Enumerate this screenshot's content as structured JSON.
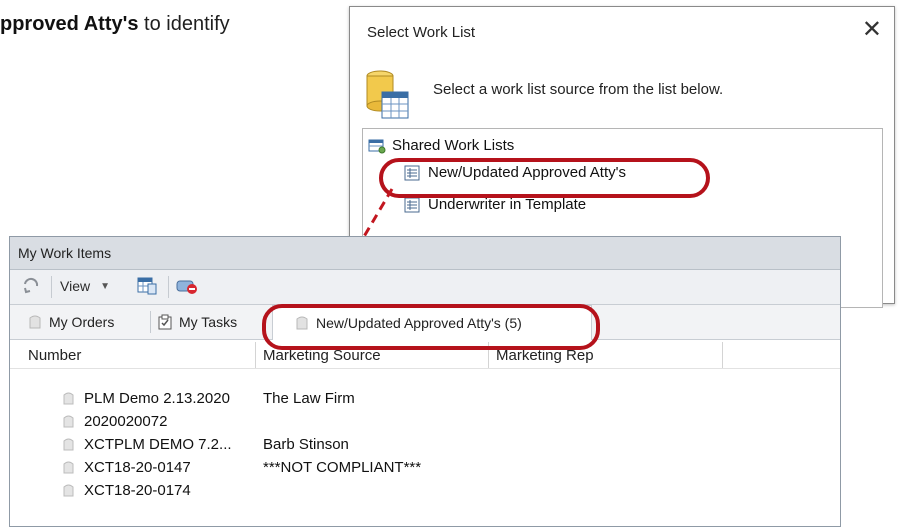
{
  "instruction": {
    "bold_part": "pproved Atty's",
    "rest": " to identify"
  },
  "dialog": {
    "title": "Select Work List",
    "close_glyph": "✕",
    "prompt": "Select a work list source from the list below.",
    "icon": "database-list-icon",
    "tree": {
      "root_label": "Shared Work Lists",
      "items": [
        {
          "label": "New/Updated Approved Atty's",
          "icon": "list-icon"
        },
        {
          "label": "Underwriter in Template",
          "icon": "list-icon"
        }
      ]
    }
  },
  "panel": {
    "title": "My Work Items",
    "toolbar": {
      "view_label": "View",
      "icons": [
        "refresh-icon",
        "chevron-down-icon",
        "grid-icon",
        "remove-worklist-icon"
      ]
    },
    "tabs": [
      {
        "label": "My Orders",
        "icon": "orders-icon"
      },
      {
        "label": "My Tasks",
        "icon": "tasks-icon"
      },
      {
        "label": "New/Updated Approved Atty's (5)",
        "icon": "orders-icon"
      }
    ],
    "columns": [
      "Number",
      "Marketing Source",
      "Marketing Rep"
    ],
    "rows": [
      {
        "number": "PLM Demo 2.13.2020",
        "marketing_source": "The Law Firm",
        "marketing_rep": ""
      },
      {
        "number": "2020020072",
        "marketing_source": "",
        "marketing_rep": ""
      },
      {
        "number": "XCTPLM DEMO 7.2...",
        "marketing_source": "Barb Stinson",
        "marketing_rep": ""
      },
      {
        "number": "XCT18-20-0147",
        "marketing_source": "***NOT COMPLIANT***",
        "marketing_rep": ""
      },
      {
        "number": "XCT18-20-0174",
        "marketing_source": "",
        "marketing_rep": ""
      }
    ]
  },
  "colors": {
    "annotation_red": "#b5121b",
    "panel_header": "#d9dde3",
    "toolbar_bg": "#eef0f3"
  }
}
